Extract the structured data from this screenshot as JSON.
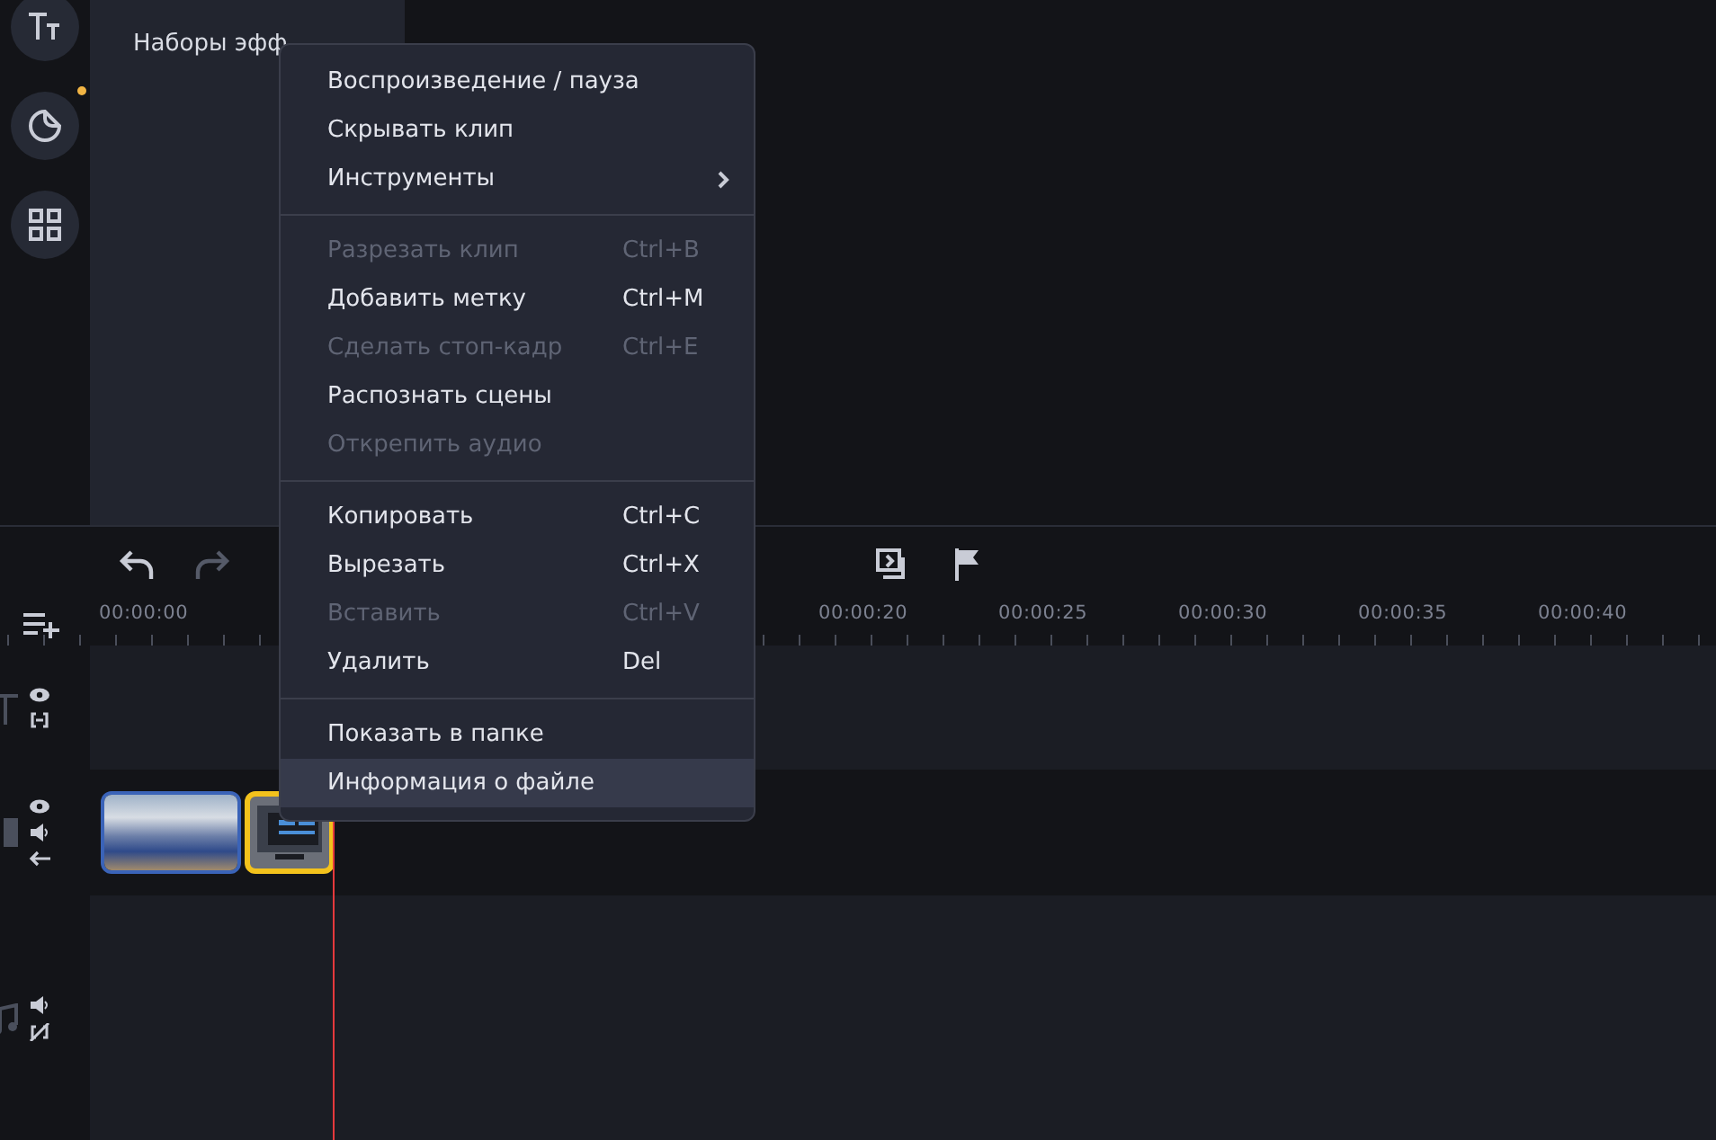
{
  "effects_panel": {
    "items": [
      {
        "label": "Наборы эфф"
      }
    ]
  },
  "timeline": {
    "ruler": [
      "00:00:00",
      "00:00:20",
      "00:00:25",
      "00:00:30",
      "00:00:35",
      "00:00:40"
    ],
    "clips": [
      {
        "kind": "photo",
        "selected": false
      },
      {
        "kind": "screen",
        "selected": true
      }
    ]
  },
  "context_menu": {
    "items": [
      {
        "kind": "item",
        "label": "Воспроизведение / пауза",
        "disabled": false,
        "submenu": false,
        "highlighted": false
      },
      {
        "kind": "item",
        "label": "Скрывать клип",
        "disabled": false,
        "submenu": false,
        "highlighted": false
      },
      {
        "kind": "item",
        "label": "Инструменты",
        "disabled": false,
        "submenu": true,
        "highlighted": false
      },
      {
        "kind": "separator"
      },
      {
        "kind": "item",
        "label": "Разрезать клип",
        "shortcut": "Ctrl+B",
        "disabled": true,
        "submenu": false,
        "highlighted": false
      },
      {
        "kind": "item",
        "label": "Добавить метку",
        "shortcut": "Ctrl+M",
        "disabled": false,
        "submenu": false,
        "highlighted": false
      },
      {
        "kind": "item",
        "label": "Сделать стоп-кадр",
        "shortcut": "Ctrl+E",
        "disabled": true,
        "submenu": false,
        "highlighted": false
      },
      {
        "kind": "item",
        "label": "Распознать сцены",
        "disabled": false,
        "submenu": false,
        "highlighted": false
      },
      {
        "kind": "item",
        "label": "Открепить аудио",
        "disabled": true,
        "submenu": false,
        "highlighted": false
      },
      {
        "kind": "separator"
      },
      {
        "kind": "item",
        "label": "Копировать",
        "shortcut": "Ctrl+C",
        "disabled": false,
        "submenu": false,
        "highlighted": false
      },
      {
        "kind": "item",
        "label": "Вырезать",
        "shortcut": "Ctrl+X",
        "disabled": false,
        "submenu": false,
        "highlighted": false
      },
      {
        "kind": "item",
        "label": "Вставить",
        "shortcut": "Ctrl+V",
        "disabled": true,
        "submenu": false,
        "highlighted": false
      },
      {
        "kind": "item",
        "label": "Удалить",
        "shortcut": "Del",
        "disabled": false,
        "submenu": false,
        "highlighted": false
      },
      {
        "kind": "separator"
      },
      {
        "kind": "item",
        "label": "Показать в папке",
        "disabled": false,
        "submenu": false,
        "highlighted": false
      },
      {
        "kind": "item",
        "label": "Информация о файле",
        "disabled": false,
        "submenu": false,
        "highlighted": true
      }
    ]
  }
}
